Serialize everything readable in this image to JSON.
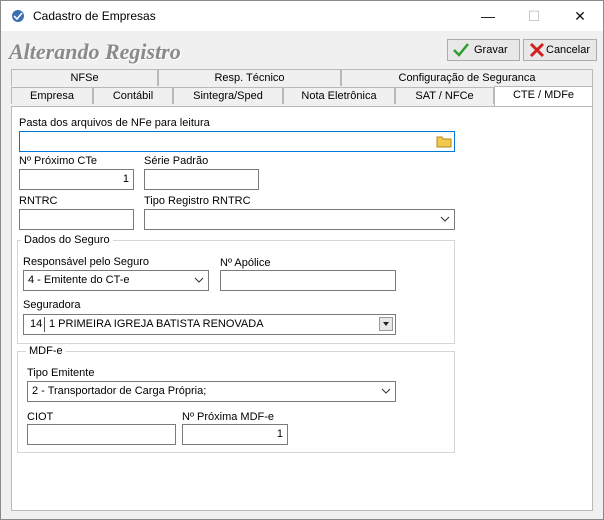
{
  "window": {
    "title": "Cadastro de Empresas"
  },
  "heading": "Alterando Registro",
  "toolbar": {
    "save_label": "Gravar",
    "cancel_label": "Cancelar"
  },
  "tabs_row1": [
    "NFSe",
    "Resp. Técnico",
    "Configuração de Seguranca"
  ],
  "tabs_row2": [
    "Empresa",
    "Contábil",
    "Sintegra/Sped",
    "Nota Eletrônica",
    "SAT / NFCe",
    "CTE / MDFe"
  ],
  "form": {
    "pasta_label": "Pasta dos arquivos de NFe para leitura",
    "pasta_value": "",
    "proximo_cte_label": "Nº Próximo CTe",
    "proximo_cte_value": "1",
    "serie_label": "Série Padrão",
    "serie_value": "",
    "rntrc_label": "RNTRC",
    "rntrc_value": "",
    "tipo_rntrc_label": "Tipo Registro RNTRC",
    "tipo_rntrc_value": ""
  },
  "seguro": {
    "group_label": "Dados do Seguro",
    "responsavel_label": "Responsável pelo Seguro",
    "responsavel_value": "4 - Emitente do CT-e",
    "apolice_label": "Nº Apólice",
    "apolice_value": "",
    "seguradora_label": "Seguradora",
    "seguradora_code": "14",
    "seguradora_name": "1 PRIMEIRA IGREJA BATISTA RENOVADA"
  },
  "mdfe": {
    "group_label": "MDF-e",
    "tipo_emitente_label": "Tipo Emitente",
    "tipo_emitente_value": "2 - Transportador de Carga Própria;",
    "ciot_label": "CIOT",
    "ciot_value": "",
    "proxima_label": "Nº Próxima MDF-e",
    "proxima_value": "1"
  },
  "colors": {
    "accent": "#0078d7",
    "heading": "#8a8a8a",
    "save_check": "#2ea02e",
    "cancel_x": "#d12020"
  }
}
